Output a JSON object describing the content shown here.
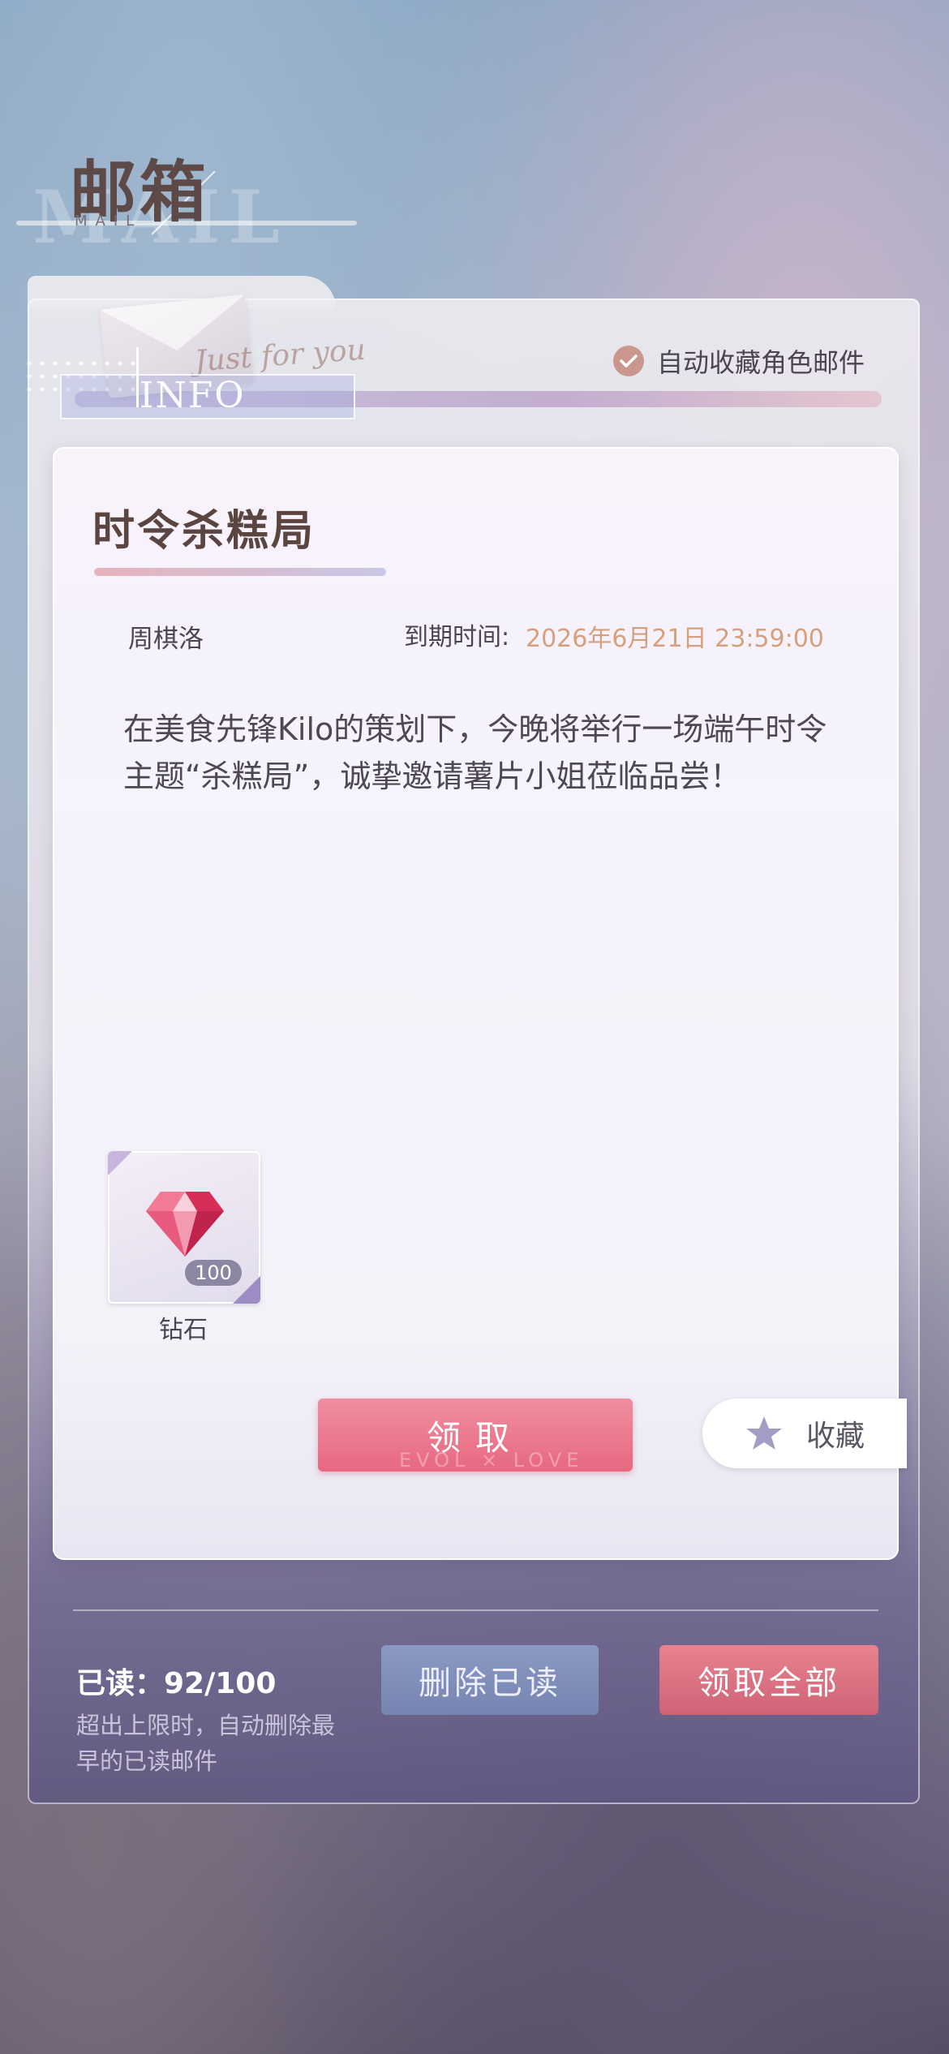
{
  "header": {
    "title": "邮箱",
    "subtitle": "MAIL",
    "ghost_title": "MAIL"
  },
  "banner": {
    "info_label": "INFO",
    "script_text": "Just for you"
  },
  "auto_favorite": {
    "label": "自动收藏角色邮件",
    "checked": true,
    "check_color": "#c9978d"
  },
  "mail": {
    "title": "时令杀糕局",
    "sender": "周棋洛",
    "expire_label": "到期时间:",
    "expire_value": "2026年6月21日 23:59:00",
    "body": "在美食先锋Kilo的策划下，今晚将举行一场端午时令主题“杀糕局”，诚挚邀请薯片小姐莅临品尝！",
    "reward": {
      "icon": "diamond-icon",
      "count": "100",
      "name": "钻石"
    },
    "claim_label": "领取",
    "claim_sub": "EVOL × LOVE",
    "favorite_label": "收藏"
  },
  "footer": {
    "read_label": "已读：92/100",
    "read_note": "超出上限时，自动删除最早的已读邮件",
    "delete_read_label": "删除已读",
    "claim_all_label": "领取全部"
  },
  "colors": {
    "accent_pink": "#e76880",
    "accent_blue": "#7684b1",
    "expire_text": "#d6a07c"
  }
}
